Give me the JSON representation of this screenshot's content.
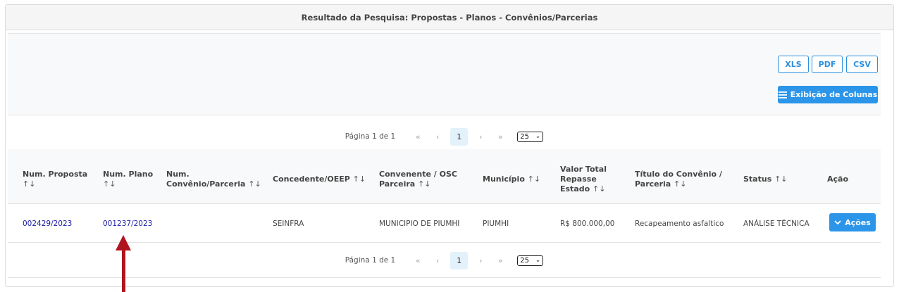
{
  "header": {
    "title": "Resultado da Pesquisa: Propostas - Planos - Convênios/Parcerias"
  },
  "toolbar": {
    "xls": "XLS",
    "pdf": "PDF",
    "csv": "CSV",
    "columns_button": "Exibição de Colunas",
    "columns_icon": "list-icon"
  },
  "pagination": {
    "text": "Página 1 de 1",
    "first": "«",
    "prev": "‹",
    "current_page": "1",
    "next": "›",
    "last": "»",
    "page_size": "25",
    "select_arrow": "⌄"
  },
  "table": {
    "sort_glyph": "↑↓",
    "columns": [
      {
        "line1": "Num. Proposta",
        "line2": ""
      },
      {
        "line1": "Num. Plano",
        "line2": ""
      },
      {
        "line1": "Num.",
        "line2": "Convênio/Parceria"
      },
      {
        "line1": "Concedente/OEEP",
        "line2": ""
      },
      {
        "line1": "Convenente / OSC",
        "line2": "Parceira"
      },
      {
        "line1": "Município",
        "line2": ""
      },
      {
        "line1": "Valor Total",
        "line2": "Repasse",
        "line3": "Estado"
      },
      {
        "line1": "Título do Convênio /",
        "line2": "Parceria"
      },
      {
        "line1": "Status",
        "line2": ""
      },
      {
        "line1": "Ação",
        "line2": ""
      }
    ],
    "rows": [
      {
        "num_proposta": "002429/2023",
        "num_plano": "001237/2023",
        "num_convenio": "",
        "concedente": "SEINFRA",
        "convenente": "MUNICIPIO DE PIUMHI",
        "municipio": "PIUMHI",
        "valor": "R$ 800.000,00",
        "titulo": "Recapeamento asfaltico",
        "status": "ANÁLISE TÉCNICA",
        "action_label": "Ações"
      }
    ]
  },
  "colors": {
    "accent": "#2b95e9",
    "link": "#1a1aa6",
    "annotation_arrow": "#b0141e"
  }
}
